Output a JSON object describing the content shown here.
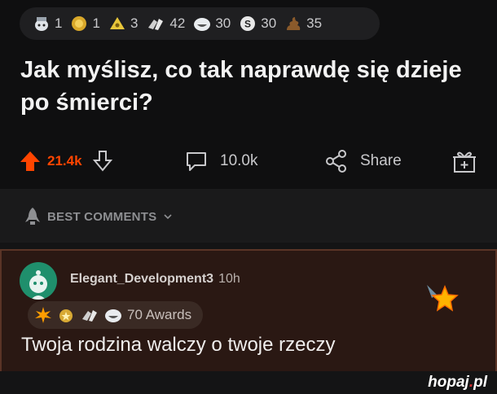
{
  "post": {
    "awards": [
      {
        "icon": "wholesome-icon",
        "count": "1"
      },
      {
        "icon": "gold-icon",
        "count": "1"
      },
      {
        "icon": "helpful-icon",
        "count": "3"
      },
      {
        "icon": "hands-icon",
        "count": "42"
      },
      {
        "icon": "laugh-icon",
        "count": "30"
      },
      {
        "icon": "silver-coin-icon",
        "count": "30"
      },
      {
        "icon": "poop-icon",
        "count": "35"
      }
    ],
    "title": "Jak myślisz, co tak naprawdę się dzieje po śmierci?",
    "upvotes": "21.4k",
    "comments": "10.0k",
    "share_label": "Share"
  },
  "sort": {
    "label": "BEST COMMENTS"
  },
  "comment": {
    "username": "Elegant_Development3",
    "time": "10h",
    "awards_label": "70 Awards",
    "text": "Twoja rodzina walczy o twoje rzeczy"
  },
  "watermark": {
    "brand": "hopaj",
    "dot": ".",
    "tld": "pl"
  },
  "colors": {
    "upvote": "#ff4500",
    "background": "#0f0f10",
    "comment_bg": "#2a1813"
  }
}
